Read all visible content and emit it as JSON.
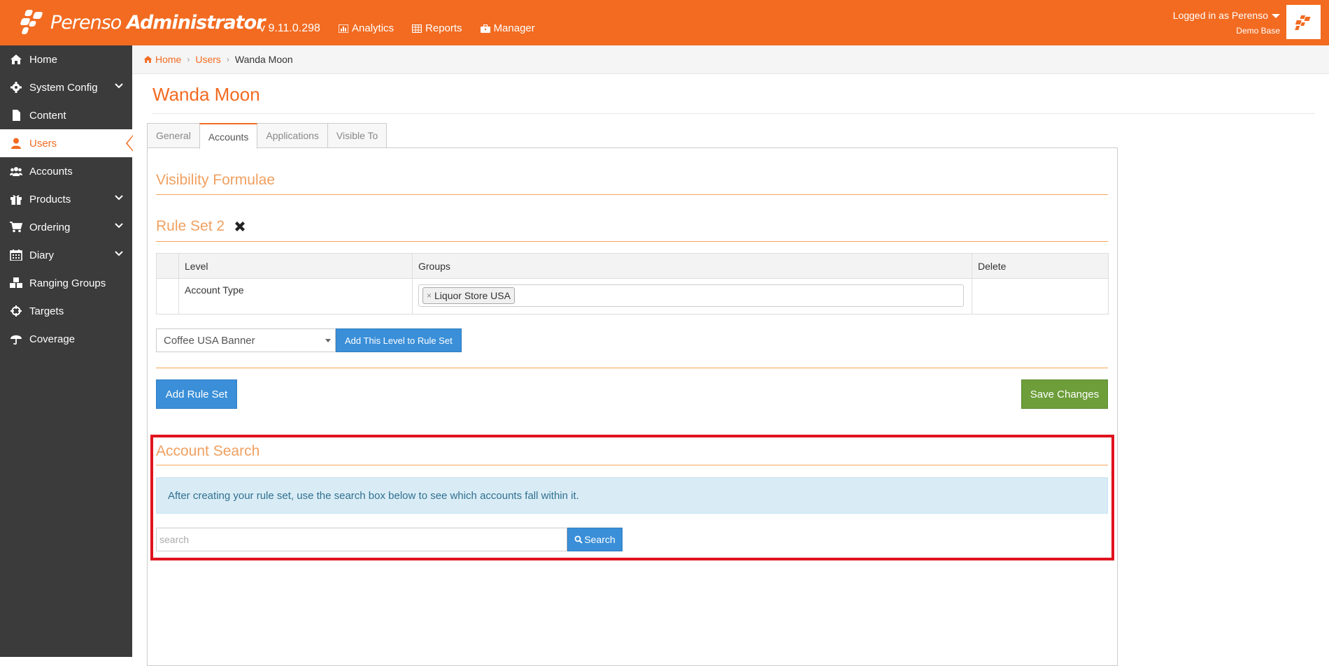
{
  "header": {
    "brand_light": "Perenso",
    "brand_bold": "Administrator",
    "version": "v 9.11.0.298",
    "nav": [
      {
        "label": "Analytics",
        "icon": "chart-icon"
      },
      {
        "label": "Reports",
        "icon": "table-icon"
      },
      {
        "label": "Manager",
        "icon": "briefcase-icon"
      }
    ],
    "user_line": "Logged in as Perenso",
    "user_sub": "Demo Base"
  },
  "sidebar": {
    "items": [
      {
        "label": "Home",
        "icon": "home-icon",
        "expandable": false
      },
      {
        "label": "System Config",
        "icon": "gear-icon",
        "expandable": true
      },
      {
        "label": "Content",
        "icon": "file-icon",
        "expandable": false
      },
      {
        "label": "Users",
        "icon": "user-icon",
        "expandable": false,
        "active": true
      },
      {
        "label": "Accounts",
        "icon": "users-icon",
        "expandable": false
      },
      {
        "label": "Products",
        "icon": "gift-icon",
        "expandable": true
      },
      {
        "label": "Ordering",
        "icon": "cart-icon",
        "expandable": true
      },
      {
        "label": "Diary",
        "icon": "calendar-icon",
        "expandable": true
      },
      {
        "label": "Ranging Groups",
        "icon": "cubes-icon",
        "expandable": false
      },
      {
        "label": "Targets",
        "icon": "crosshairs-icon",
        "expandable": false
      },
      {
        "label": "Coverage",
        "icon": "umbrella-icon",
        "expandable": false
      }
    ]
  },
  "breadcrumb": {
    "home": "Home",
    "users": "Users",
    "current": "Wanda Moon"
  },
  "page": {
    "title": "Wanda Moon",
    "tabs": [
      "General",
      "Accounts",
      "Applications",
      "Visible To"
    ],
    "active_tab": "Accounts"
  },
  "visibility": {
    "title": "Visibility Formulae",
    "rule_set_title": "Rule Set 2",
    "table": {
      "headers": [
        "",
        "Level",
        "Groups",
        "Delete"
      ],
      "rows": [
        {
          "level": "Account Type",
          "tags": [
            "Liquor Store USA"
          ],
          "tag_remove": "×"
        }
      ]
    },
    "level_select_value": "Coffee USA Banner",
    "add_level_button": "Add This Level to Rule Set",
    "add_rule_set_button": "Add Rule Set",
    "save_button": "Save Changes"
  },
  "account_search": {
    "title": "Account Search",
    "info": "After creating your rule set, use the search box below to see which accounts fall within it.",
    "placeholder": "search",
    "button": "Search"
  },
  "colors": {
    "brand": "#f26b21",
    "sidebar": "#3b3b3b",
    "primary_button": "#3a8fd8",
    "success_button": "#6d9e3a",
    "highlight": "#e0141e"
  }
}
